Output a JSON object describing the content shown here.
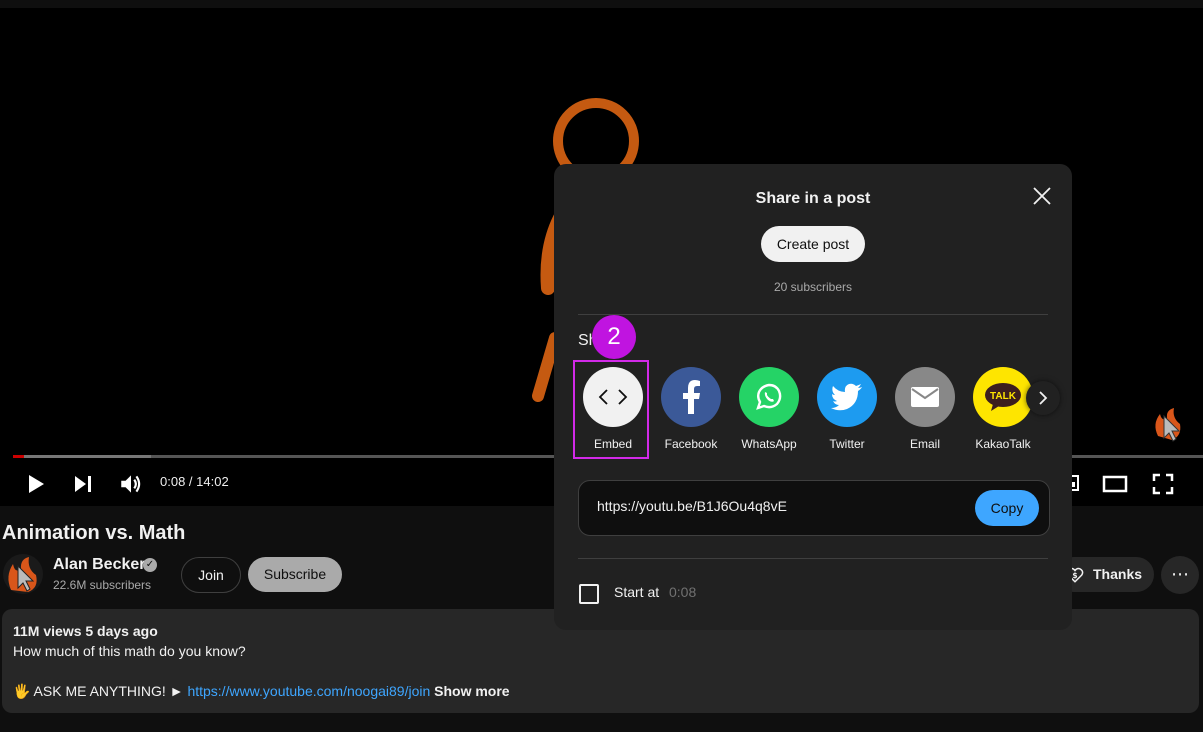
{
  "player": {
    "time": "0:08 / 14:02",
    "progress_fraction": 0.0095,
    "buffered_fraction": 0.116
  },
  "video": {
    "title": "Animation vs. Math",
    "channel": "Alan Becker",
    "subscribers": "22.6M subscribers",
    "join_label": "Join",
    "subscribe_label": "Subscribe",
    "thanks_label": "Thanks",
    "more_label": "⋯"
  },
  "description": {
    "meta": "11M views  5 days ago",
    "line1": "How much of this math do you know?",
    "line2_prefix": "🖐 ASK ME ANYTHING! ► ",
    "line2_link": "https://www.youtube.com/noogai89/join",
    "show_more": "Show more"
  },
  "share": {
    "post_title": "Share in a post",
    "create_post": "Create post",
    "post_subscribers": "20 subscribers",
    "share_heading": "Share",
    "targets": [
      {
        "label": "Embed",
        "icon": "embed-icon",
        "bg": "#f1f1f1"
      },
      {
        "label": "Facebook",
        "icon": "facebook-icon",
        "bg": "#3b5998"
      },
      {
        "label": "WhatsApp",
        "icon": "whatsapp-icon",
        "bg": "#25d366"
      },
      {
        "label": "Twitter",
        "icon": "twitter-icon",
        "bg": "#1d9bf0"
      },
      {
        "label": "Email",
        "icon": "email-icon",
        "bg": "#888888"
      },
      {
        "label": "KakaoTalk",
        "icon": "kakaotalk-icon",
        "bg": "#fee500",
        "icon_text": "TALK"
      }
    ],
    "url": "https://youtu.be/B1J6Ou4q8vE",
    "copy_label": "Copy",
    "start_at_label": "Start at",
    "start_at_time": "0:08"
  },
  "annotation": {
    "badge_number": "2",
    "color": "#d22ae8"
  }
}
